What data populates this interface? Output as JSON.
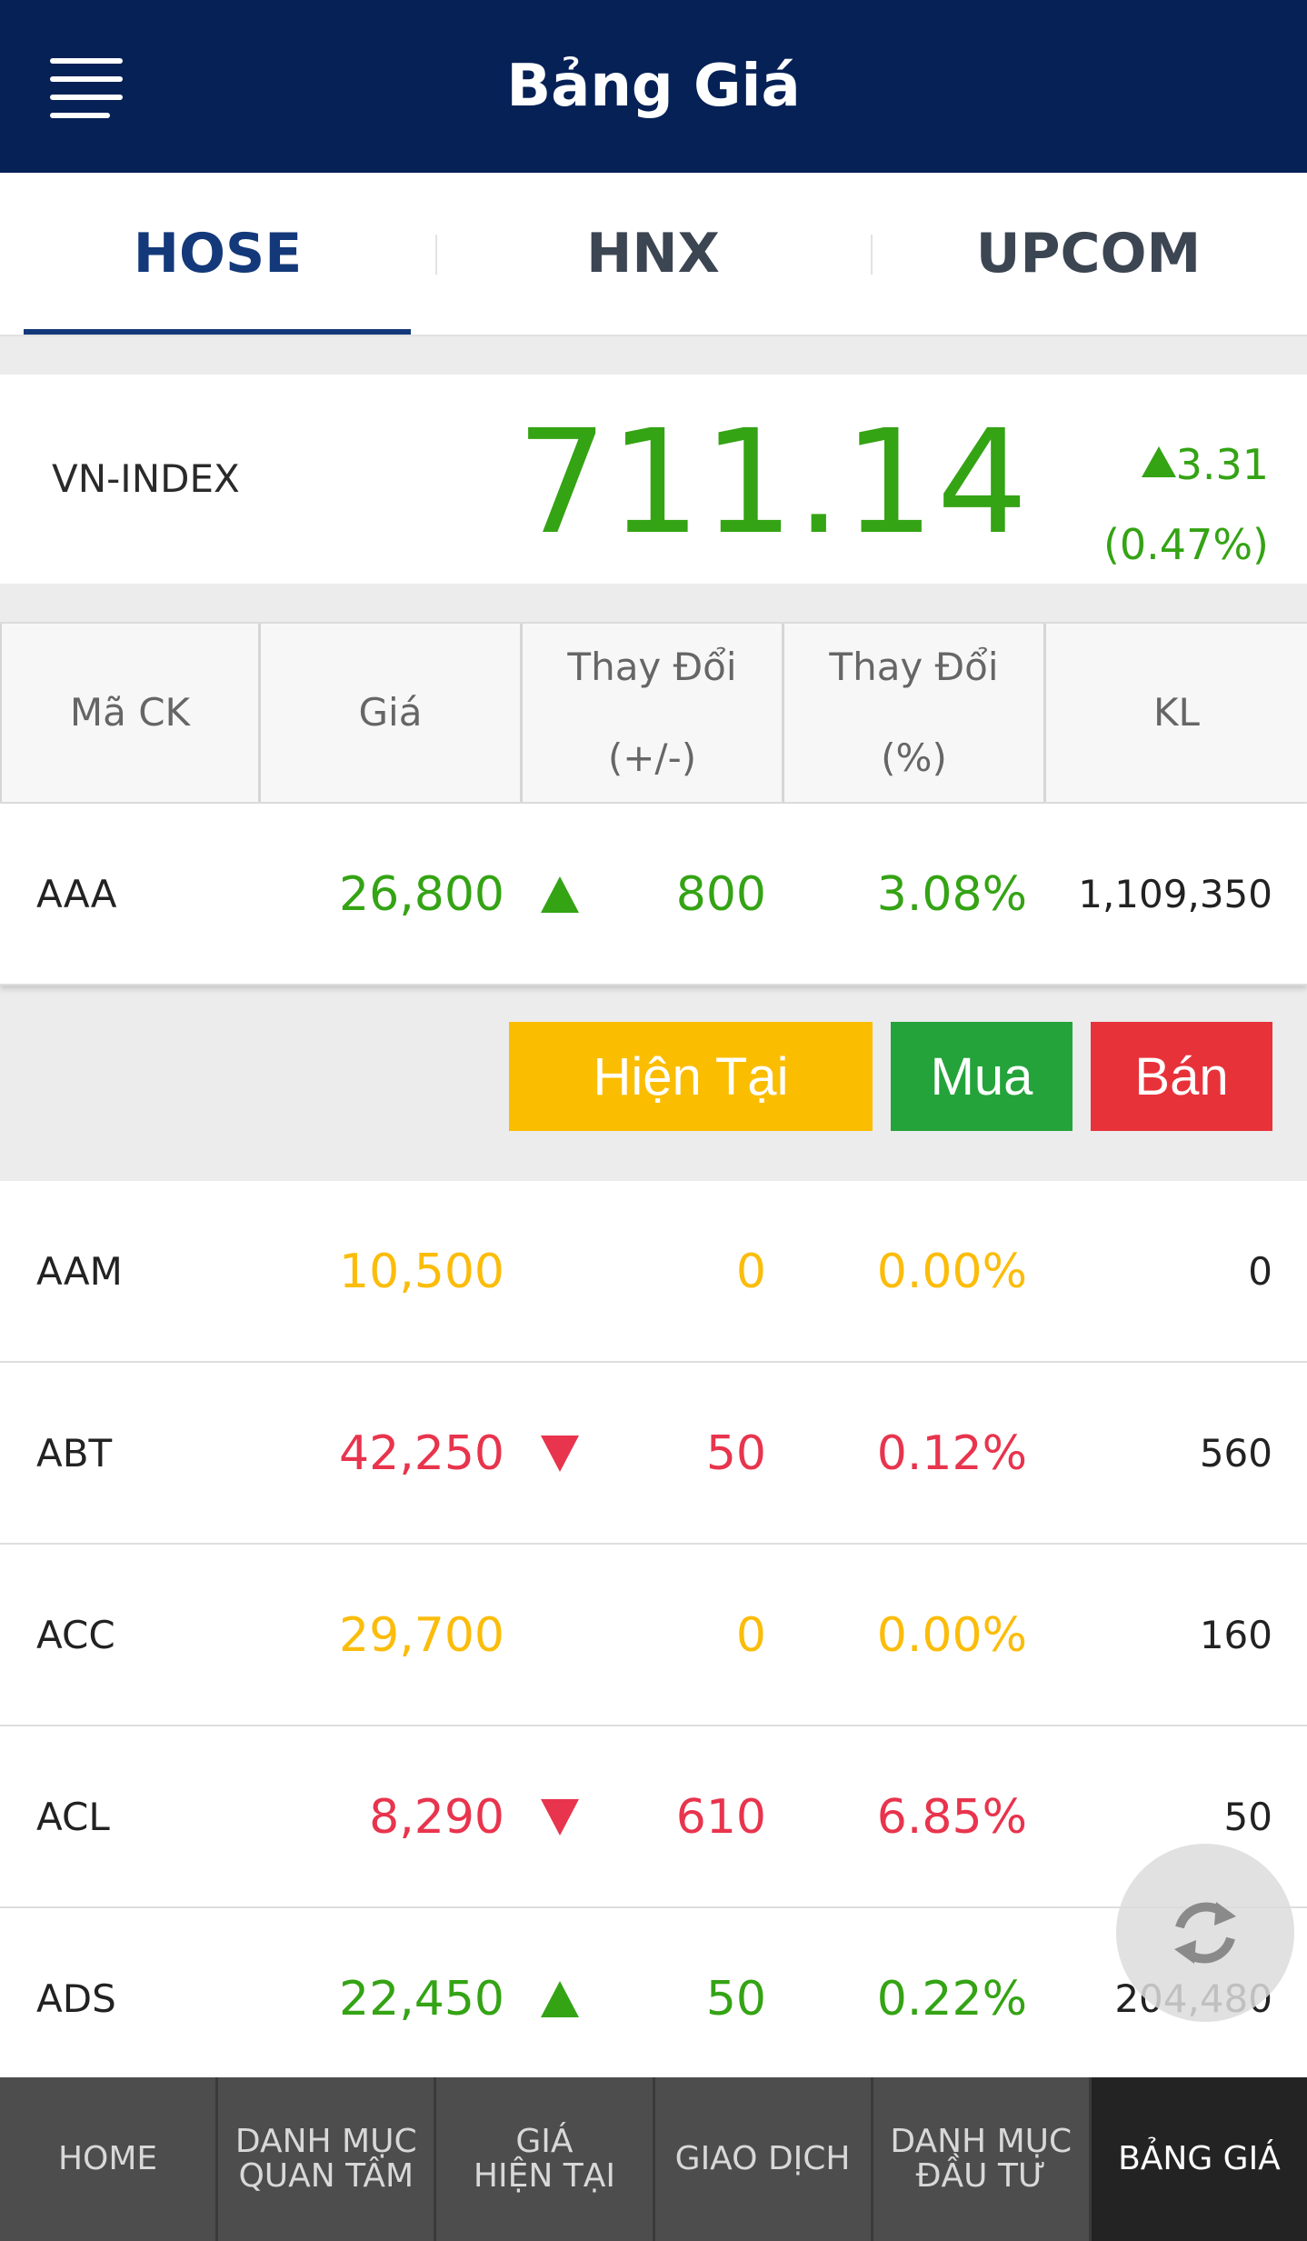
{
  "header": {
    "title": "Bảng Giá",
    "menu_icon": "hamburger-menu-icon"
  },
  "tabs": [
    {
      "label": "HOSE",
      "active": true
    },
    {
      "label": "HNX",
      "active": false
    },
    {
      "label": "UPCOM",
      "active": false
    }
  ],
  "index": {
    "name": "VN-INDEX",
    "value": "711.14",
    "change": "3.31",
    "change_pct": "(0.47%)",
    "direction": "up"
  },
  "table_header": {
    "symbol": "Mã CK",
    "price": "Giá",
    "change_line1": "Thay Đổi",
    "change_line2": "(+/-)",
    "pct_line1": "Thay Đổi",
    "pct_line2": "(%)",
    "volume": "KL"
  },
  "rows": [
    {
      "symbol": "AAA",
      "price": "26,800",
      "change": "800",
      "pct": "3.08%",
      "volume": "1,109,350",
      "status": "up"
    },
    {
      "symbol": "AAM",
      "price": "10,500",
      "change": "0",
      "pct": "0.00%",
      "volume": "0",
      "status": "ref"
    },
    {
      "symbol": "ABT",
      "price": "42,250",
      "change": "50",
      "pct": "0.12%",
      "volume": "560",
      "status": "down"
    },
    {
      "symbol": "ACC",
      "price": "29,700",
      "change": "0",
      "pct": "0.00%",
      "volume": "160",
      "status": "ref"
    },
    {
      "symbol": "ACL",
      "price": "8,290",
      "change": "610",
      "pct": "6.85%",
      "volume": "50",
      "status": "down"
    },
    {
      "symbol": "ADS",
      "price": "22,450",
      "change": "50",
      "pct": "0.22%",
      "volume": "204,480",
      "status": "up"
    }
  ],
  "actions": {
    "current": "Hiện Tại",
    "buy": "Mua",
    "sell": "Bán"
  },
  "colors": {
    "header_bg": "#052156",
    "up": "#34a314",
    "down": "#e8344d",
    "reference": "#fbbc0a",
    "buy": "#24a33a",
    "sell": "#e8323a",
    "current": "#fbbd00"
  },
  "refresh_icon": "refresh-icon",
  "bottom_nav": [
    {
      "label": "HOME",
      "active": false
    },
    {
      "label_line1": "DANH MỤC",
      "label_line2": "QUAN TÂM",
      "active": false
    },
    {
      "label_line1": "GIÁ",
      "label_line2": "HIỆN TẠI",
      "active": false
    },
    {
      "label": "GIAO DỊCH",
      "active": false
    },
    {
      "label_line1": "DANH MỤC",
      "label_line2": "ĐẦU TƯ",
      "active": false
    },
    {
      "label": "BẢNG GIÁ",
      "active": true
    }
  ]
}
